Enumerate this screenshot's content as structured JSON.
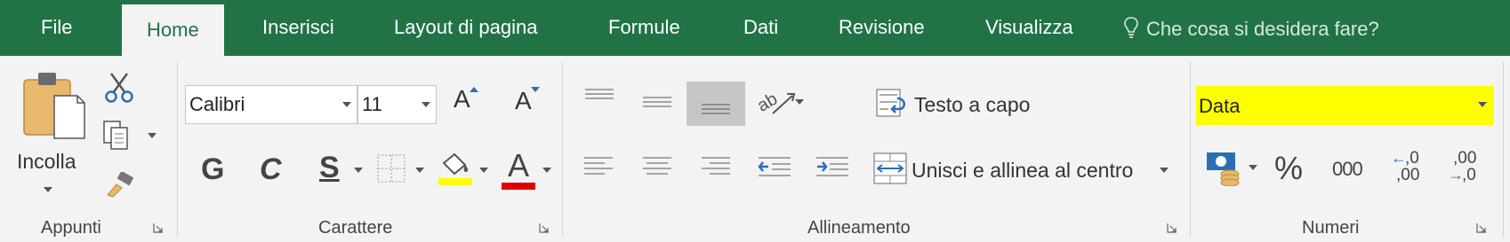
{
  "tabs": {
    "file": "File",
    "home": "Home",
    "insert": "Inserisci",
    "page_layout": "Layout di pagina",
    "formulas": "Formule",
    "data": "Dati",
    "review": "Revisione",
    "view": "Visualizza"
  },
  "tell_me": {
    "placeholder": "Che cosa si desidera fare?",
    "icon": "lightbulb-icon"
  },
  "clipboard": {
    "paste_label": "Incolla",
    "group_label": "Appunti"
  },
  "font": {
    "name": "Calibri",
    "size": "11",
    "bold": "G",
    "italic": "C",
    "underline": "S",
    "color_letter": "A",
    "grow_letter": "A",
    "shrink_letter": "A",
    "group_label": "Carattere",
    "highlight_color": "#ffff00",
    "font_color": "#e00000"
  },
  "alignment": {
    "wrap_text": "Testo a capo",
    "merge_center": "Unisci e allinea al centro",
    "group_label": "Allineamento"
  },
  "number": {
    "format": "Data",
    "percent": "%",
    "thousands": "000",
    "inc_decimal_top": ",0",
    "inc_decimal_bottom": ",00",
    "dec_decimal_top": ",00",
    "dec_decimal_bottom": ",0",
    "group_label": "Numeri",
    "format_highlight": "#ffff00"
  },
  "colors": {
    "accent": "#217346",
    "ribbon": "#f3f3f3"
  }
}
